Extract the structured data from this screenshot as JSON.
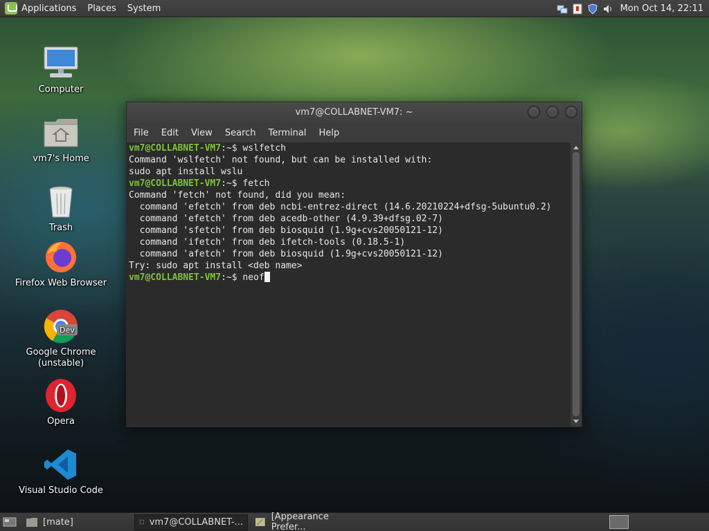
{
  "top_panel": {
    "menus": [
      "Applications",
      "Places",
      "System"
    ],
    "clock": "Mon Oct 14, 22:11",
    "tray_icons": [
      "network-icon",
      "update-manager-icon",
      "shield-icon",
      "volume-icon"
    ]
  },
  "desktop": {
    "icons": [
      {
        "label": "Computer",
        "icon": "computer-icon"
      },
      {
        "label": "vm7's Home",
        "icon": "home-folder-icon"
      },
      {
        "label": "Trash",
        "icon": "trash-icon"
      },
      {
        "label": "Firefox Web Browser",
        "icon": "firefox-icon"
      },
      {
        "label": "Google Chrome (unstable)",
        "icon": "chrome-dev-icon"
      },
      {
        "label": "Opera",
        "icon": "opera-icon"
      },
      {
        "label": "Visual Studio Code",
        "icon": "vscode-icon"
      }
    ]
  },
  "terminal": {
    "title": "vm7@COLLABNET-VM7: ~",
    "menu": [
      "File",
      "Edit",
      "View",
      "Search",
      "Terminal",
      "Help"
    ],
    "prompt_user": "vm7@COLLABNET-VM7",
    "prompt_path": ":~$ ",
    "cmd1": "wslfetch",
    "out1": [
      "Command 'wslfetch' not found, but can be installed with:",
      "sudo apt install wslu"
    ],
    "cmd2": "fetch",
    "out2": [
      "Command 'fetch' not found, did you mean:",
      "  command 'efetch' from deb ncbi-entrez-direct (14.6.20210224+dfsg-5ubuntu0.2)",
      "  command 'efetch' from deb acedb-other (4.9.39+dfsg.02-7)",
      "  command 'sfetch' from deb biosquid (1.9g+cvs20050121-12)",
      "  command 'ifetch' from deb ifetch-tools (0.18.5-1)",
      "  command 'afetch' from deb biosquid (1.9g+cvs20050121-12)",
      "Try: sudo apt install <deb name>"
    ],
    "current_input": "neof"
  },
  "bottom_panel": {
    "tasks": [
      {
        "label": "[mate]",
        "icon": "folder-icon"
      },
      {
        "label": "vm7@COLLABNET-...",
        "icon": "terminal-icon"
      },
      {
        "label": "[Appearance Prefer...",
        "icon": "appearance-icon"
      }
    ]
  }
}
